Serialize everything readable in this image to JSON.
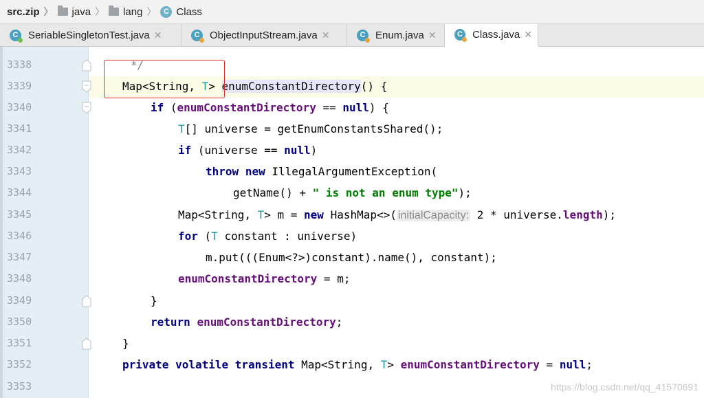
{
  "breadcrumb": [
    "src.zip",
    "java",
    "lang",
    "Class"
  ],
  "breadcrumb_icons": [
    "archive",
    "folder-icon",
    "folder-icon",
    "class-icon"
  ],
  "tabs": [
    {
      "label": "SeriableSingletonTest.java",
      "icon": "C",
      "active": false
    },
    {
      "label": "ObjectInputStream.java",
      "icon": "C",
      "active": false
    },
    {
      "label": "Enum.java",
      "icon": "C",
      "active": false
    },
    {
      "label": "Class.java",
      "icon": "C",
      "active": true
    }
  ],
  "lines": [
    {
      "num": "3338"
    },
    {
      "num": "3339"
    },
    {
      "num": "3340"
    },
    {
      "num": "3341"
    },
    {
      "num": "3342"
    },
    {
      "num": "3343"
    },
    {
      "num": "3344"
    },
    {
      "num": "3345"
    },
    {
      "num": "3346"
    },
    {
      "num": "3347"
    },
    {
      "num": "3348"
    },
    {
      "num": "3349"
    },
    {
      "num": "3350"
    },
    {
      "num": "3351"
    },
    {
      "num": "3352"
    },
    {
      "num": "3353"
    }
  ],
  "code": {
    "l3338": "*/",
    "l3339_a": "Map<String, ",
    "l3339_t": "T",
    "l3339_b": "> ",
    "l3339_m": "enumConstantDirectory",
    "l3339_c": "() {",
    "kw_if": "if",
    "kw_null": "null",
    "kw_throw": "throw",
    "kw_new": "new",
    "kw_for": "for",
    "kw_return": "return",
    "kw_private": "private",
    "kw_volatile": "volatile",
    "kw_transient": "transient",
    "field": "enumConstantDirectory",
    "field_length": "length",
    "type_T": "T",
    "l3340_a": " (",
    "l3340_b": " == ",
    "l3340_c": ") {",
    "l3341_b": "[] universe = getEnumConstantsShared();",
    "l3342_b": " (universe == ",
    "l3342_c": ")",
    "l3343_b": " IllegalArgumentException(",
    "l3344_a": "getName() + ",
    "l3344_s": "\" is not an enum type\"",
    "l3344_b": ");",
    "l3345_a": "Map<String, ",
    "l3345_b": "> m = ",
    "l3345_c": " HashMap<>(",
    "l3345_hint": "initialCapacity:",
    "l3345_d": " 2 * universe.",
    "l3345_e": ");",
    "l3346_a": " (",
    "l3346_b": " constant : universe)",
    "l3347": "m.put(((Enum<?>)constant).name(), constant);",
    "l3348_b": " = m;",
    "l3349": "}",
    "l3350_b": ";",
    "l3351": "}",
    "l3352_a": " Map<String, ",
    "l3352_b": "> ",
    "l3352_c": " = ",
    "l3352_d": ";"
  },
  "watermark": "https://blog.csdn.net/qq_41570691",
  "colors": {
    "keyword": "#000080",
    "field": "#660e7a",
    "type_param": "#20999d",
    "string": "#008000",
    "annotation_box": "#e22a2a"
  }
}
